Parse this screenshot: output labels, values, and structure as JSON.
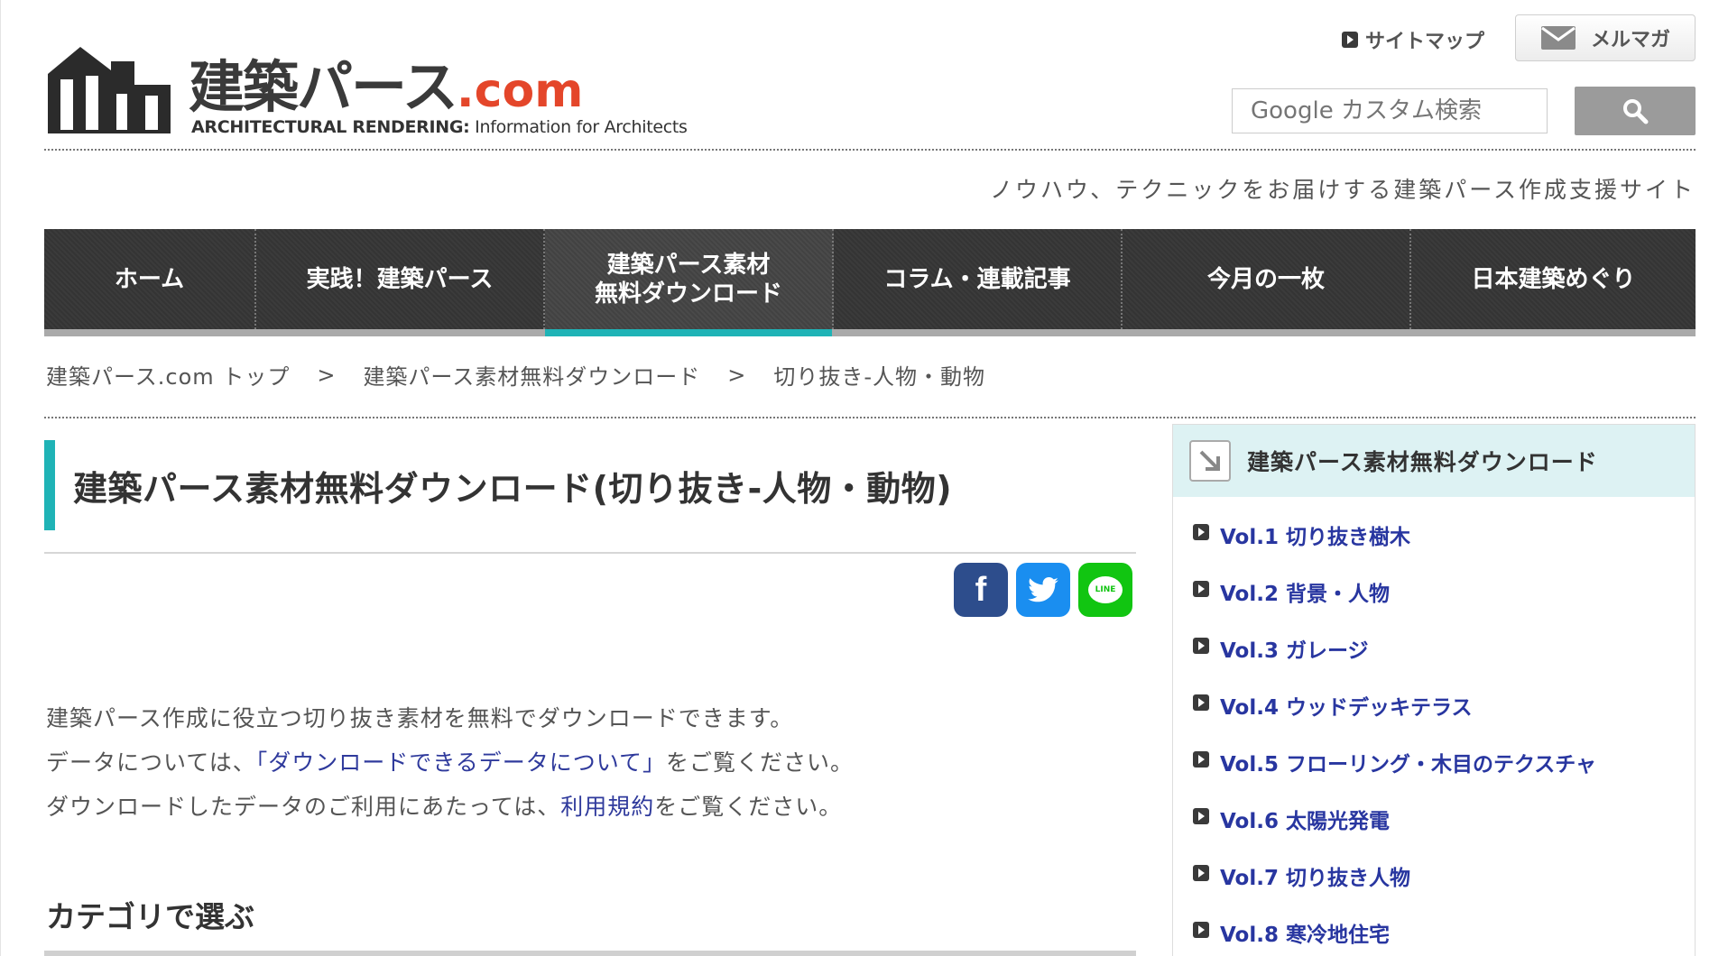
{
  "header": {
    "logo_title": "建築パース",
    "logo_tld": ".com",
    "logo_sub_bold": "ARCHITECTURAL RENDERING:",
    "logo_sub_light": " Information for Architects",
    "sitemap_label": "サイトマップ",
    "mailmag_label": "メルマガ",
    "search_placeholder": "Google カスタム検索",
    "tagline": "ノウハウ、テクニックをお届けする建築パース作成支援サイト"
  },
  "nav": {
    "items": [
      {
        "line1": "ホーム",
        "line2": ""
      },
      {
        "line1": "実践！建築パース",
        "line2": ""
      },
      {
        "line1": "建築パース素材",
        "line2": "無料ダウンロード"
      },
      {
        "line1": "コラム・連載記事",
        "line2": ""
      },
      {
        "line1": "今月の一枚",
        "line2": ""
      },
      {
        "line1": "日本建築めぐり",
        "line2": ""
      }
    ],
    "active_index": 2
  },
  "breadcrumb": {
    "items": [
      "建築パース.com トップ",
      "建築パース素材無料ダウンロード",
      "切り抜き-人物・動物"
    ],
    "separator": ">"
  },
  "main": {
    "heading": "建築パース素材無料ダウンロード(切り抜き-人物・動物)",
    "intro": {
      "line1": "建築パース作成に役立つ切り抜き素材を無料でダウンロードできます。",
      "line2_pre": "データについては、",
      "line2_link": "「ダウンロードできるデータについて」",
      "line2_post": "をご覧ください。",
      "line3_pre": "ダウンロードしたデータのご利用にあたっては、",
      "line3_link": "利用規約",
      "line3_post": "をご覧ください。"
    },
    "category_heading": "カテゴリで選ぶ"
  },
  "share": {
    "fb_glyph": "f",
    "ln_glyph": "LINE"
  },
  "sidebar": {
    "title": "建築パース素材無料ダウンロード",
    "items": [
      "Vol.1 切り抜き樹木",
      "Vol.2 背景・人物",
      "Vol.3 ガレージ",
      "Vol.4 ウッドデッキテラス",
      "Vol.5 フローリング・木目のテクスチャ",
      "Vol.6 太陽光発電",
      "Vol.7 切り抜き人物",
      "Vol.8 寒冷地住宅"
    ]
  },
  "colors": {
    "accent": "#1fb3b6",
    "link": "#2836a0",
    "logo_com": "#e4462a",
    "facebook": "#2d4d8c",
    "twitter": "#1a8ef0",
    "line": "#11c511"
  }
}
